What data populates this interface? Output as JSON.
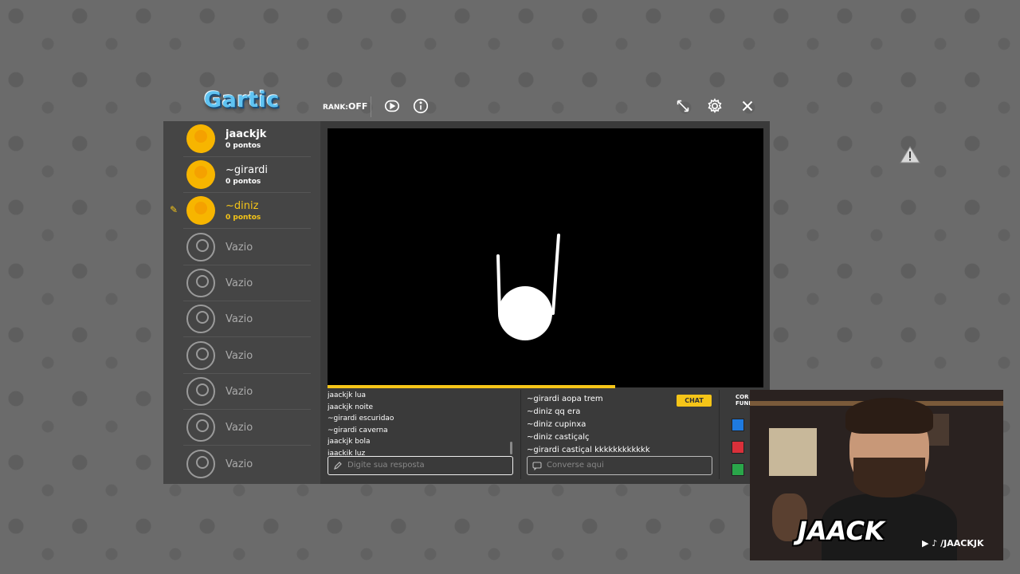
{
  "app": {
    "logo": "Gartic",
    "rank_label": "RANK:",
    "rank_value": "OFF"
  },
  "header_icons": [
    "play-circle-icon",
    "info-icon",
    "expand-icon",
    "gear-icon",
    "close-icon"
  ],
  "players": [
    {
      "name": "jaackjk",
      "points": "0 pontos",
      "state": "self"
    },
    {
      "name": "~girardi",
      "points": "0 pontos",
      "state": "normal"
    },
    {
      "name": "~diniz",
      "points": "0 pontos",
      "state": "drawing"
    },
    {
      "name": "Vazio"
    },
    {
      "name": "Vazio"
    },
    {
      "name": "Vazio"
    },
    {
      "name": "Vazio"
    },
    {
      "name": "Vazio"
    },
    {
      "name": "Vazio"
    },
    {
      "name": "Vazio"
    }
  ],
  "answers": [
    {
      "user": "jaackjk",
      "text": "lua"
    },
    {
      "user": "jaackjk",
      "text": "noite"
    },
    {
      "user": "~girardi",
      "text": "escuridao"
    },
    {
      "user": "~girardi",
      "text": "caverna"
    },
    {
      "user": "jaackjk",
      "text": "bola"
    },
    {
      "user": "jaackjk",
      "text": "luz"
    }
  ],
  "answer_input": {
    "placeholder": "Digite sua resposta"
  },
  "chat": {
    "badge": "CHAT",
    "messages": [
      {
        "user": "~girardi",
        "text": "aopa trem"
      },
      {
        "user": "~diniz",
        "text": "qq era"
      },
      {
        "user": "~diniz",
        "text": "cupinxa"
      },
      {
        "user": "~diniz",
        "text": "castiçalç"
      },
      {
        "user": "~girardi",
        "text": "castiçal kkkkkkkkkkkk"
      }
    ],
    "placeholder": "Converse aqui"
  },
  "colors": {
    "label_line1": "COR",
    "label_line2": "FUND",
    "swatches": [
      "#1e7ae0",
      "#d9303a",
      "#2aa64a"
    ]
  },
  "timer_progress": 0.66,
  "webcam": {
    "brand": "JAACK",
    "handle": "/JAACKJK"
  }
}
